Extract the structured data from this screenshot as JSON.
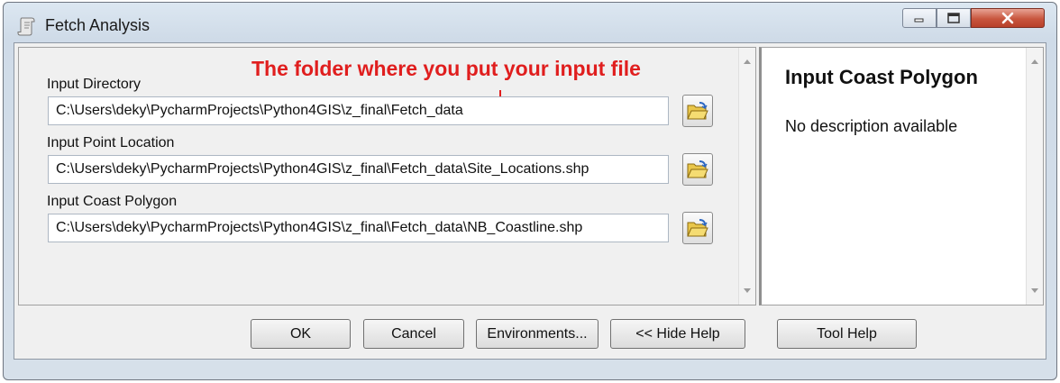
{
  "window": {
    "title": "Fetch Analysis"
  },
  "controls": {
    "minimize": "minimize",
    "maximize": "maximize",
    "close": "close"
  },
  "form": {
    "annotation": "The folder where you put your input file",
    "fields": [
      {
        "label": "Input Directory",
        "value": "C:\\Users\\deky\\PycharmProjects\\Python4GIS\\z_final\\Fetch_data"
      },
      {
        "label": "Input Point Location",
        "value": "C:\\Users\\deky\\PycharmProjects\\Python4GIS\\z_final\\Fetch_data\\Site_Locations.shp"
      },
      {
        "label": "Input Coast Polygon",
        "value": "C:\\Users\\deky\\PycharmProjects\\Python4GIS\\z_final\\Fetch_data\\NB_Coastline.shp"
      }
    ]
  },
  "help": {
    "title": "Input Coast Polygon",
    "text": "No description available"
  },
  "buttons": {
    "ok": "OK",
    "cancel": "Cancel",
    "environments": "Environments...",
    "hide_help": "<< Hide Help",
    "tool_help": "Tool Help"
  },
  "colors": {
    "annotation": "#e01e1e",
    "close_button": "#c8553d",
    "window_frame": "#d6e0ea"
  },
  "icons": [
    "script-tool-icon",
    "minimize-icon",
    "maximize-icon",
    "close-icon",
    "open-folder-icon",
    "down-arrow-icon"
  ]
}
